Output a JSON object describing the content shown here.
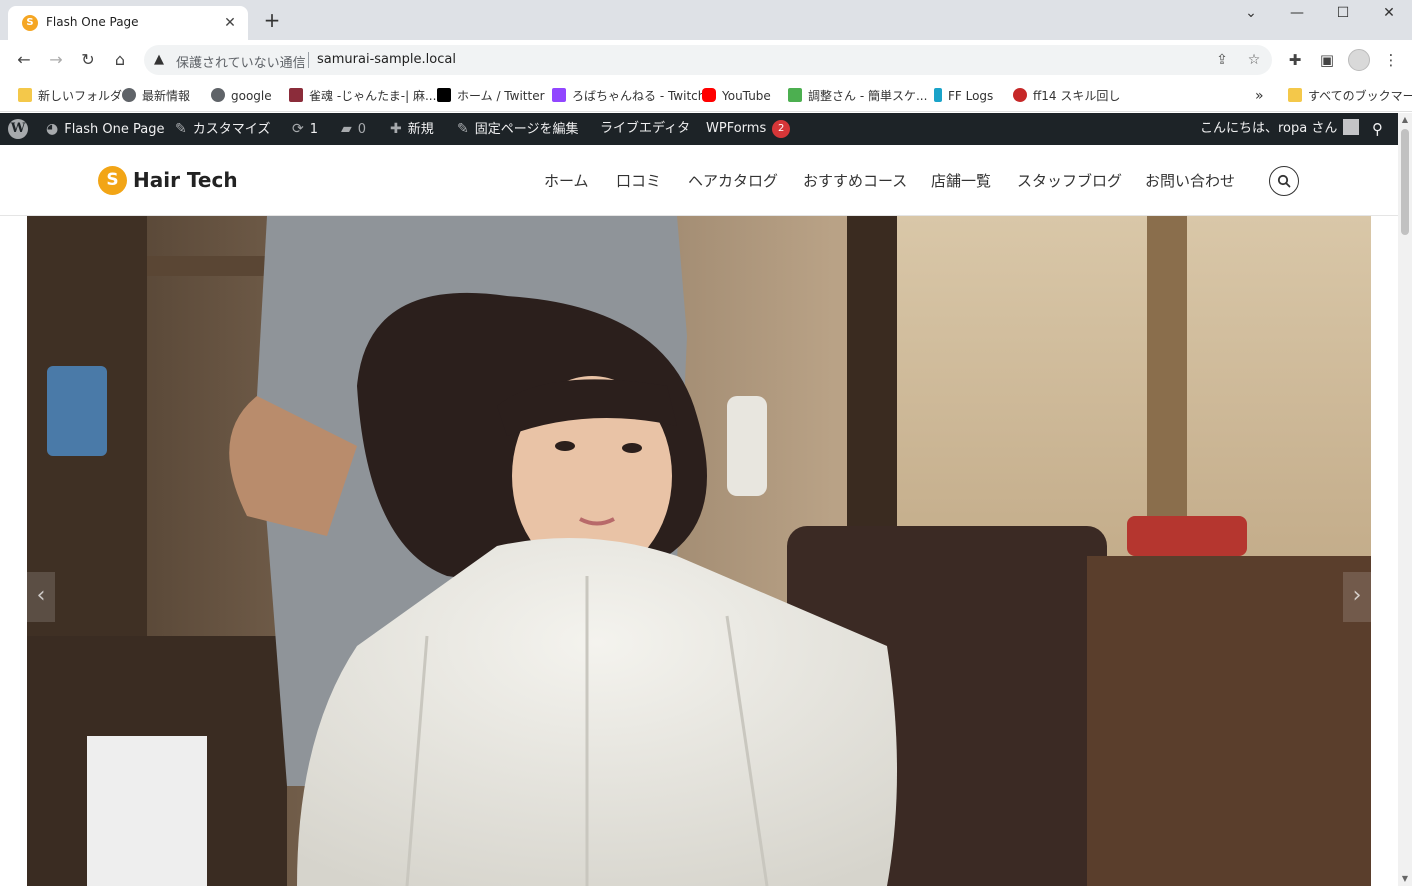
{
  "browser": {
    "tab": {
      "title": "Flash One Page",
      "favicon": "S",
      "close": "✕"
    },
    "new_tab": "+",
    "window": {
      "dropdown": "⌄",
      "minimize": "—",
      "maximize": "☐",
      "close": "✕"
    },
    "nav": {
      "back": "←",
      "forward": "→",
      "reload": "↻",
      "home": "⌂"
    },
    "omnibox": {
      "security_label": "保護されていない通信",
      "url": "samurai-sample.local",
      "warn_icon": "▲",
      "share_icon": "⇪",
      "star_icon": "☆"
    },
    "toolbar_icons": {
      "extensions": "✚",
      "sidepanel": "▣",
      "menu": "⋮"
    },
    "bookmarks": [
      {
        "label": "新しいフォルダ",
        "icon": "folder-icon",
        "color": "#f4c84a"
      },
      {
        "label": "最新情報",
        "icon": "chrome-icon",
        "color": "#5f6368"
      },
      {
        "label": "google",
        "icon": "globe-icon",
        "color": "#5f6368"
      },
      {
        "label": "雀魂 -じゃんたま-| 麻...",
        "icon": "mahjong-icon",
        "color": "#8b2c3a"
      },
      {
        "label": "ホーム / Twitter",
        "icon": "x-icon",
        "color": "#000000"
      },
      {
        "label": "ろばちゃんねる - Twitch",
        "icon": "twitch-icon",
        "color": "#9146ff"
      },
      {
        "label": "YouTube",
        "icon": "youtube-icon",
        "color": "#ff0000"
      },
      {
        "label": "調整さん - 簡単スケ...",
        "icon": "chouseisan-icon",
        "color": "#4caf50"
      },
      {
        "label": "FF Logs",
        "icon": "fflogs-icon",
        "color": "#1aa3c9"
      },
      {
        "label": "ff14 スキル回し",
        "icon": "ff14-icon",
        "color": "#c62828"
      }
    ],
    "bookmarks_overflow": "»",
    "all_bookmarks": "すべてのブックマーク"
  },
  "wp_admin_bar": {
    "site_name": "Flash One Page",
    "customize": "カスタマイズ",
    "updates_count": "1",
    "comments_count": "0",
    "new": "新規",
    "edit_page": "固定ページを編集",
    "live_editor": "ライブエディタ",
    "wpforms": "WPForms",
    "wpforms_badge": "2",
    "greeting": "こんにちは、ropa さん"
  },
  "site": {
    "logo_mark": "S",
    "logo_text": "Hair Tech",
    "nav": [
      "ホーム",
      "口コミ",
      "ヘアカタログ",
      "おすすめコース",
      "店舗一覧",
      "スタッフブログ",
      "お問い合わせ"
    ]
  },
  "hero": {
    "prev": "‹",
    "next": "›"
  },
  "colors": {
    "accent": "#f2a516",
    "admin_bar": "#1d2327",
    "badge": "#d63638"
  }
}
